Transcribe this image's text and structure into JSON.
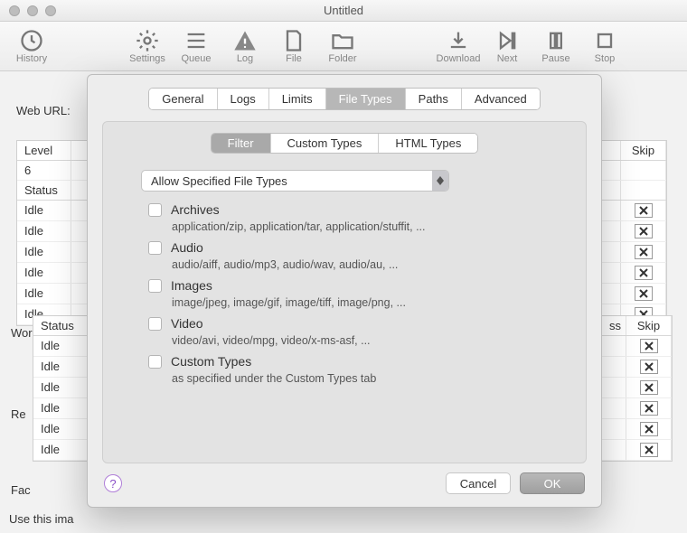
{
  "window": {
    "title": "Untitled"
  },
  "toolbar": {
    "history": "History",
    "settings": "Settings",
    "queue": "Queue",
    "log": "Log",
    "file": "File",
    "folder": "Folder",
    "download": "Download",
    "next": "Next",
    "pause": "Pause",
    "stop": "Stop"
  },
  "bg": {
    "web_url_label": "Web URL:",
    "headers": {
      "level": "Level",
      "status": "Status",
      "skip": "Skip",
      "ss": "ss"
    },
    "level_value": "6",
    "idle": "Idle",
    "wor_label": "Wor",
    "re_label": "Re",
    "fac_label": "Fac",
    "bottom_text": "Use this ima"
  },
  "modal": {
    "tabs": {
      "general": "General",
      "logs": "Logs",
      "limits": "Limits",
      "file_types": "File Types",
      "paths": "Paths",
      "advanced": "Advanced"
    },
    "subtabs": {
      "filter": "Filter",
      "custom_types": "Custom Types",
      "html_types": "HTML Types"
    },
    "select": {
      "value": "Allow Specified File Types"
    },
    "categories": [
      {
        "title": "Archives",
        "desc": "application/zip, application/tar, application/stuffit, ..."
      },
      {
        "title": "Audio",
        "desc": "audio/aiff, audio/mp3, audio/wav, audio/au, ..."
      },
      {
        "title": "Images",
        "desc": "image/jpeg, image/gif, image/tiff, image/png, ..."
      },
      {
        "title": "Video",
        "desc": "video/avi, video/mpg, video/x-ms-asf, ..."
      },
      {
        "title": "Custom Types",
        "desc": "as specified under the Custom Types tab"
      }
    ],
    "buttons": {
      "cancel": "Cancel",
      "ok": "OK"
    }
  }
}
